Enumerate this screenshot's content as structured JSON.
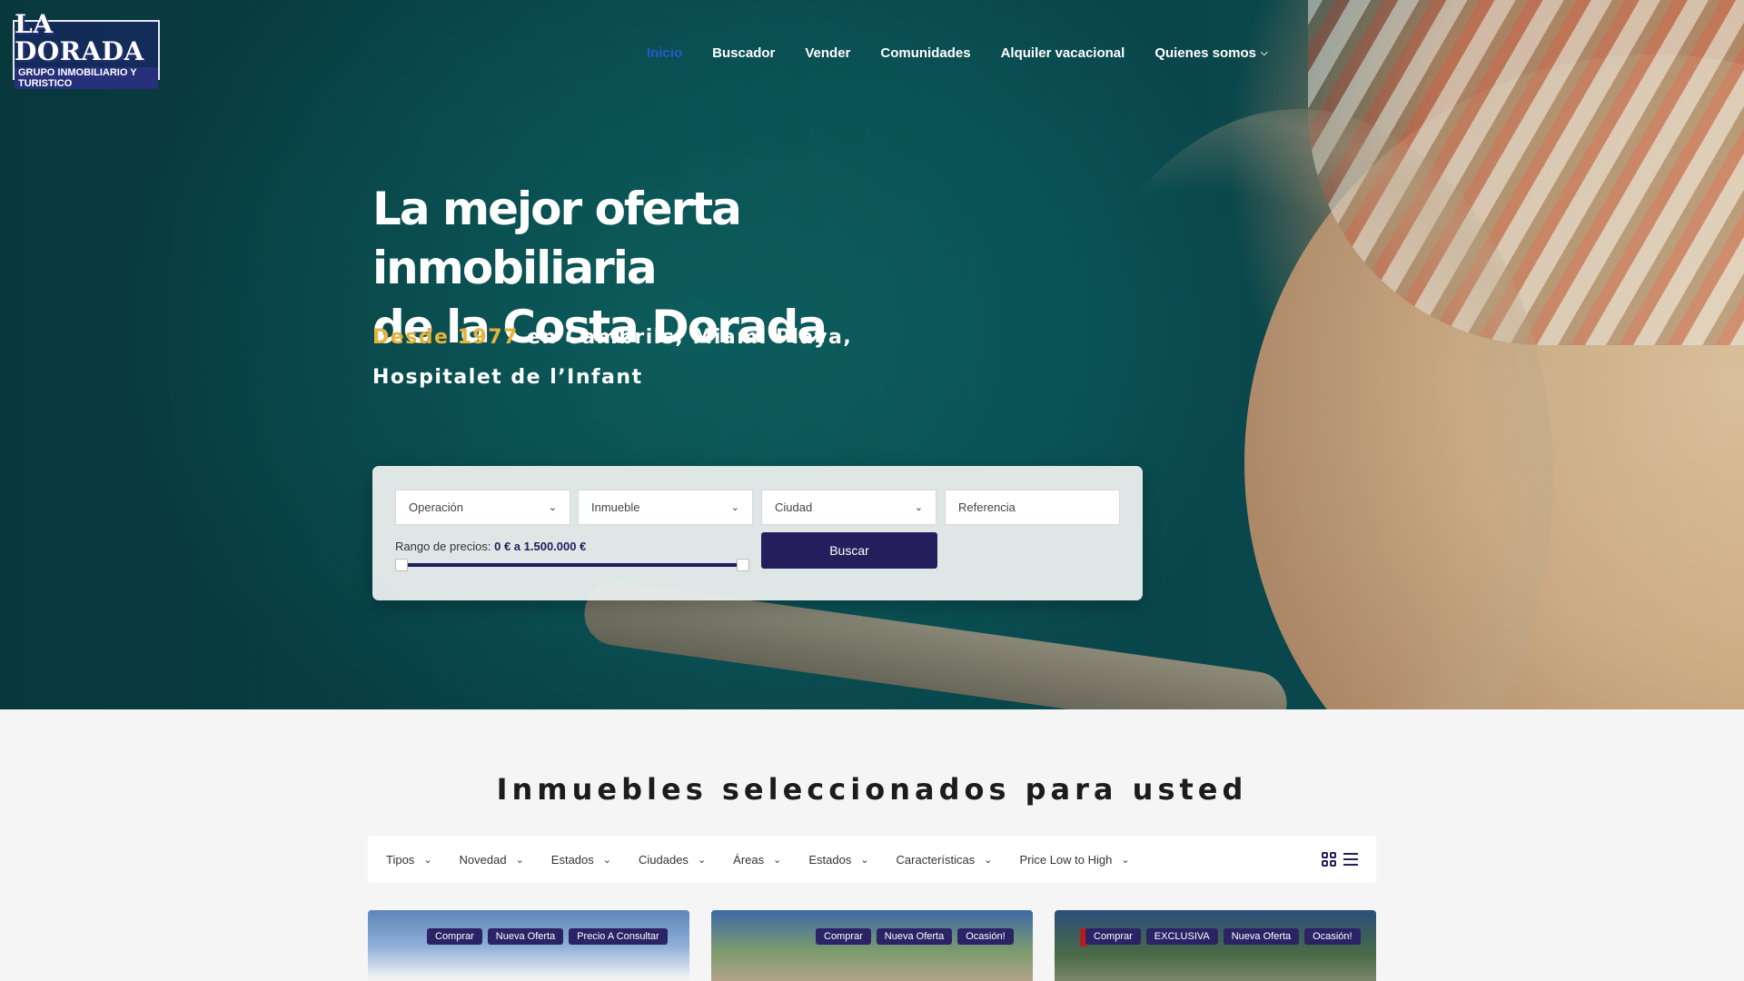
{
  "logo": {
    "title": "LA DORADA",
    "subtitle": "GRUPO INMOBILIARIO Y TURISTICO"
  },
  "nav": [
    {
      "label": "Inicio",
      "active": true
    },
    {
      "label": "Buscador"
    },
    {
      "label": "Vender"
    },
    {
      "label": "Comunidades"
    },
    {
      "label": "Alquiler vacacional"
    },
    {
      "label": "Quienes somos",
      "has_dropdown": true
    }
  ],
  "hero": {
    "title_line1": "La mejor oferta inmobiliaria",
    "title_line2": "de la Costa Dorada",
    "sub_accent": "Desde 1977",
    "sub_rest": " en Cambrils, Miami Playa, Hospitalet de l’Infant"
  },
  "search": {
    "operacion": "Operación",
    "inmueble": "Inmueble",
    "ciudad": "Ciudad",
    "referencia": "Referencia",
    "range_label": "Rango de precios: ",
    "range_value": "0 € a 1.500.000 €",
    "price_min_fraction": 0,
    "price_max_fraction": 1,
    "button": "Buscar"
  },
  "section": {
    "title": "Inmuebles seleccionados para usted",
    "filters": [
      "Tipos",
      "Novedad",
      "Estados",
      "Ciudades",
      "Áreas",
      "Estados",
      "Características",
      "Price Low to High"
    ]
  },
  "cards": [
    {
      "badges": [
        "Comprar",
        "Nueva Oferta",
        "Precio A Consultar"
      ]
    },
    {
      "badges": [
        "Comprar",
        "Nueva Oferta",
        "Ocasión!"
      ]
    },
    {
      "badges": [
        "Comprar",
        "EXCLUSIVA",
        "Nueva Oferta",
        "Ocasión!"
      ]
    }
  ],
  "colors": {
    "nav_active": "#2a58c8",
    "accent_gold": "#e4b43a",
    "brand_navy": "#241e5c",
    "badge_bg": "#2a2466"
  }
}
